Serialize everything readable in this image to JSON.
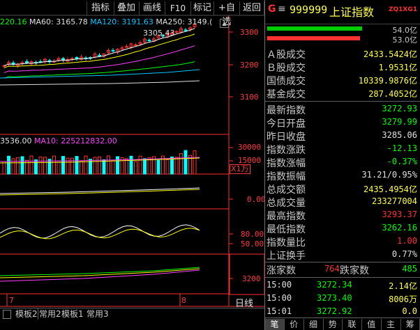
{
  "toolbar": {
    "buttons": [
      "指标",
      "叠加",
      "画线",
      "F10",
      "标记",
      "+自选",
      "返回"
    ],
    "scroll_up": "▲",
    "scroll_down": "▼"
  },
  "chart": {
    "ma_line": {
      "ma60_prefix": "220.16",
      "ma60": "MA60: 3165.78",
      "ma120": "MA120: 3191.63",
      "ma250": "MA250: 3149.("
    },
    "high_label": "3305.43",
    "price_axis": [
      "3300",
      "3200",
      "3100"
    ],
    "vol_line": {
      "ma5": "3536.00",
      "ma10": "MA10: 225212832.00"
    },
    "vol_axis": [
      "30000",
      "15000"
    ],
    "vol_unit": "X1万",
    "ind1_axis": "0.00",
    "ind2_axis": [
      "80.00",
      "50.00"
    ],
    "ind3_axis": "3200",
    "date_labels": [
      "7",
      "8"
    ]
  },
  "bottom_tabs": [
    "模板2",
    "常用2",
    "模板1",
    "常用3"
  ],
  "bottom_period": "日线",
  "panel": {
    "badge": "G",
    "menu_glyph": "≡",
    "code": "999999",
    "name": "上证指数",
    "tag": "ZQ1XG1",
    "bars": [
      {
        "value": "54.0亿",
        "fill": 0.85,
        "color": "#00cc00"
      },
      {
        "value": "53.0亿",
        "fill": 0.83,
        "color": "#ff3030"
      }
    ],
    "turnover": [
      {
        "label": "Ａ股成交",
        "value": "2433.5424亿"
      },
      {
        "label": "Ｂ股成交",
        "value": "1.9531亿"
      },
      {
        "label": "国债成交",
        "value": "10339.9876亿"
      },
      {
        "label": "基金成交",
        "value": "287.4052亿"
      }
    ],
    "stats": [
      {
        "label": "最新指数",
        "value": "3272.93",
        "color": "#00ff00"
      },
      {
        "label": "今日开盘",
        "value": "3279.99",
        "color": "#00ff00"
      },
      {
        "label": "昨日收盘",
        "value": "3285.06",
        "color": "#e0e0e0"
      },
      {
        "label": "指数涨跌",
        "value": "-12.13",
        "color": "#00ff00"
      },
      {
        "label": "指数涨幅",
        "value": "-0.37%",
        "color": "#00ff00"
      },
      {
        "label": "指数振幅",
        "value": "31.21/0.95%",
        "color": "#e0e0e0"
      },
      {
        "label": "总成交额",
        "value": "2435.4954亿",
        "color": "#ffff40"
      },
      {
        "label": "总成交量",
        "value": "233277004",
        "color": "#ffff40"
      },
      {
        "label": "最高指数",
        "value": "3293.37",
        "color": "#ff3030"
      },
      {
        "label": "最低指数",
        "value": "3262.16",
        "color": "#00ff00"
      },
      {
        "label": "指数量比",
        "value": "1.00",
        "color": "#ff3030"
      },
      {
        "label": "上证换手",
        "value": "0.77%",
        "color": "#e0e0e0"
      }
    ],
    "breadth": {
      "up_label": "涨家数",
      "up": "764",
      "down_label": "跌家数",
      "down": "485"
    },
    "ticks": [
      {
        "time": "15:00",
        "price": "3272.34",
        "vol": "2.14亿"
      },
      {
        "time": "15:00",
        "price": "3273.40",
        "vol": "8006万"
      },
      {
        "time": "15:01",
        "price": "3272.92",
        "vol": "0.0"
      }
    ],
    "tabs": [
      "笔",
      "价",
      "细",
      "势",
      "联",
      "值",
      "主",
      "筹"
    ]
  },
  "colors": {
    "up": "#ff3030",
    "down": "#00ffff",
    "ma5": "#ffffff",
    "ma10": "#ffff00",
    "ma20": "#ff40ff",
    "ma60": "#00ff00"
  }
}
